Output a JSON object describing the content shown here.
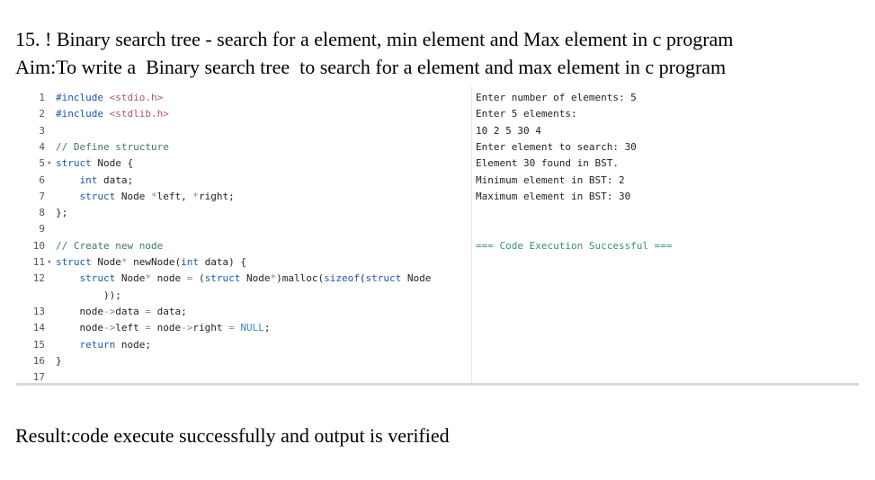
{
  "document": {
    "title": "15. ! Binary search tree - search for a element, min element and Max element in c program",
    "aim": "Aim:To write a  Binary search tree  to search for a element and max element in c program",
    "result": "Result:code execute successfully and output is verified"
  },
  "editor": {
    "lines": [
      {
        "num": "1",
        "fold": "",
        "parts": [
          {
            "t": "#include ",
            "c": "pp"
          },
          {
            "t": "<stdio.h>",
            "c": "str"
          }
        ]
      },
      {
        "num": "2",
        "fold": "",
        "parts": [
          {
            "t": "#include ",
            "c": "pp"
          },
          {
            "t": "<stdlib.h>",
            "c": "str"
          }
        ]
      },
      {
        "num": "3",
        "fold": "",
        "parts": []
      },
      {
        "num": "4",
        "fold": "",
        "parts": [
          {
            "t": "// Define structure",
            "c": "cm"
          }
        ]
      },
      {
        "num": "5",
        "fold": "▾",
        "parts": [
          {
            "t": "struct",
            "c": "kw"
          },
          {
            "t": " Node {",
            "c": ""
          }
        ]
      },
      {
        "num": "6",
        "fold": "",
        "parts": [
          {
            "t": "    ",
            "c": ""
          },
          {
            "t": "int",
            "c": "kw"
          },
          {
            "t": " data;",
            "c": ""
          }
        ]
      },
      {
        "num": "7",
        "fold": "",
        "parts": [
          {
            "t": "    ",
            "c": ""
          },
          {
            "t": "struct",
            "c": "kw"
          },
          {
            "t": " Node ",
            "c": ""
          },
          {
            "t": "*",
            "c": "op"
          },
          {
            "t": "left, ",
            "c": ""
          },
          {
            "t": "*",
            "c": "op"
          },
          {
            "t": "right;",
            "c": ""
          }
        ]
      },
      {
        "num": "8",
        "fold": "",
        "parts": [
          {
            "t": "};",
            "c": ""
          }
        ]
      },
      {
        "num": "9",
        "fold": "",
        "parts": []
      },
      {
        "num": "10",
        "fold": "",
        "parts": [
          {
            "t": "// Create new node",
            "c": "cm"
          }
        ]
      },
      {
        "num": "11",
        "fold": "▾",
        "parts": [
          {
            "t": "struct",
            "c": "kw"
          },
          {
            "t": " Node",
            "c": ""
          },
          {
            "t": "*",
            "c": "op"
          },
          {
            "t": " newNode(",
            "c": ""
          },
          {
            "t": "int",
            "c": "kw"
          },
          {
            "t": " data) {",
            "c": ""
          }
        ]
      },
      {
        "num": "12",
        "fold": "",
        "parts": [
          {
            "t": "    ",
            "c": ""
          },
          {
            "t": "struct",
            "c": "kw"
          },
          {
            "t": " Node",
            "c": ""
          },
          {
            "t": "*",
            "c": "op"
          },
          {
            "t": " node ",
            "c": ""
          },
          {
            "t": "=",
            "c": "op"
          },
          {
            "t": " (",
            "c": ""
          },
          {
            "t": "struct",
            "c": "kw"
          },
          {
            "t": " Node",
            "c": ""
          },
          {
            "t": "*",
            "c": "op"
          },
          {
            "t": ")malloc(",
            "c": ""
          },
          {
            "t": "sizeof",
            "c": "kw"
          },
          {
            "t": "(",
            "c": ""
          },
          {
            "t": "struct",
            "c": "kw"
          },
          {
            "t": " Node",
            "c": ""
          }
        ]
      },
      {
        "num": "",
        "fold": "",
        "parts": [
          {
            "t": "        ));",
            "c": ""
          }
        ]
      },
      {
        "num": "13",
        "fold": "",
        "parts": [
          {
            "t": "    node",
            "c": ""
          },
          {
            "t": "->",
            "c": "op"
          },
          {
            "t": "data ",
            "c": ""
          },
          {
            "t": "=",
            "c": "op"
          },
          {
            "t": " data;",
            "c": ""
          }
        ]
      },
      {
        "num": "14",
        "fold": "",
        "parts": [
          {
            "t": "    node",
            "c": ""
          },
          {
            "t": "->",
            "c": "op"
          },
          {
            "t": "left ",
            "c": ""
          },
          {
            "t": "=",
            "c": "op"
          },
          {
            "t": " node",
            "c": ""
          },
          {
            "t": "->",
            "c": "op"
          },
          {
            "t": "right ",
            "c": ""
          },
          {
            "t": "=",
            "c": "op"
          },
          {
            "t": " ",
            "c": ""
          },
          {
            "t": "NULL",
            "c": "nul"
          },
          {
            "t": ";",
            "c": ""
          }
        ]
      },
      {
        "num": "15",
        "fold": "",
        "parts": [
          {
            "t": "    ",
            "c": ""
          },
          {
            "t": "return",
            "c": "kw"
          },
          {
            "t": " node;",
            "c": ""
          }
        ]
      },
      {
        "num": "16",
        "fold": "",
        "parts": [
          {
            "t": "}",
            "c": ""
          }
        ]
      },
      {
        "num": "17",
        "fold": "",
        "parts": []
      }
    ]
  },
  "output": {
    "lines": [
      {
        "text": "Enter number of elements: 5",
        "style": ""
      },
      {
        "text": "Enter 5 elements:",
        "style": ""
      },
      {
        "text": "10 2 5 30 4",
        "style": ""
      },
      {
        "text": "Enter element to search: 30",
        "style": ""
      },
      {
        "text": "Element 30 found in BST.",
        "style": ""
      },
      {
        "text": "Minimum element in BST: 2",
        "style": ""
      },
      {
        "text": "Maximum element in BST: 30",
        "style": ""
      },
      {
        "text": "",
        "style": ""
      },
      {
        "text": "",
        "style": ""
      },
      {
        "text": "=== Code Execution Successful ===",
        "style": "success"
      }
    ]
  }
}
